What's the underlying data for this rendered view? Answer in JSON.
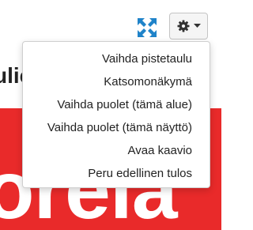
{
  "background": {
    "heading_fragment": "ulic",
    "banner_text": "orela",
    "banner_color": "#e92a2a"
  },
  "toolbar": {
    "expand_icon": "expand-arrows-icon",
    "expand_icon_color": "#1f83c9",
    "settings_icon": "gear-icon",
    "dropdown_icon": "caret-down-icon"
  },
  "menu": {
    "items": [
      {
        "label": "Vaihda pistetaulu"
      },
      {
        "label": "Katsomonäkymä"
      },
      {
        "label": "Vaihda puolet (tämä alue)"
      },
      {
        "label": "Vaihda puolet (tämä näyttö)"
      },
      {
        "label": "Avaa kaavio"
      },
      {
        "label": "Peru edellinen tulos"
      }
    ]
  }
}
